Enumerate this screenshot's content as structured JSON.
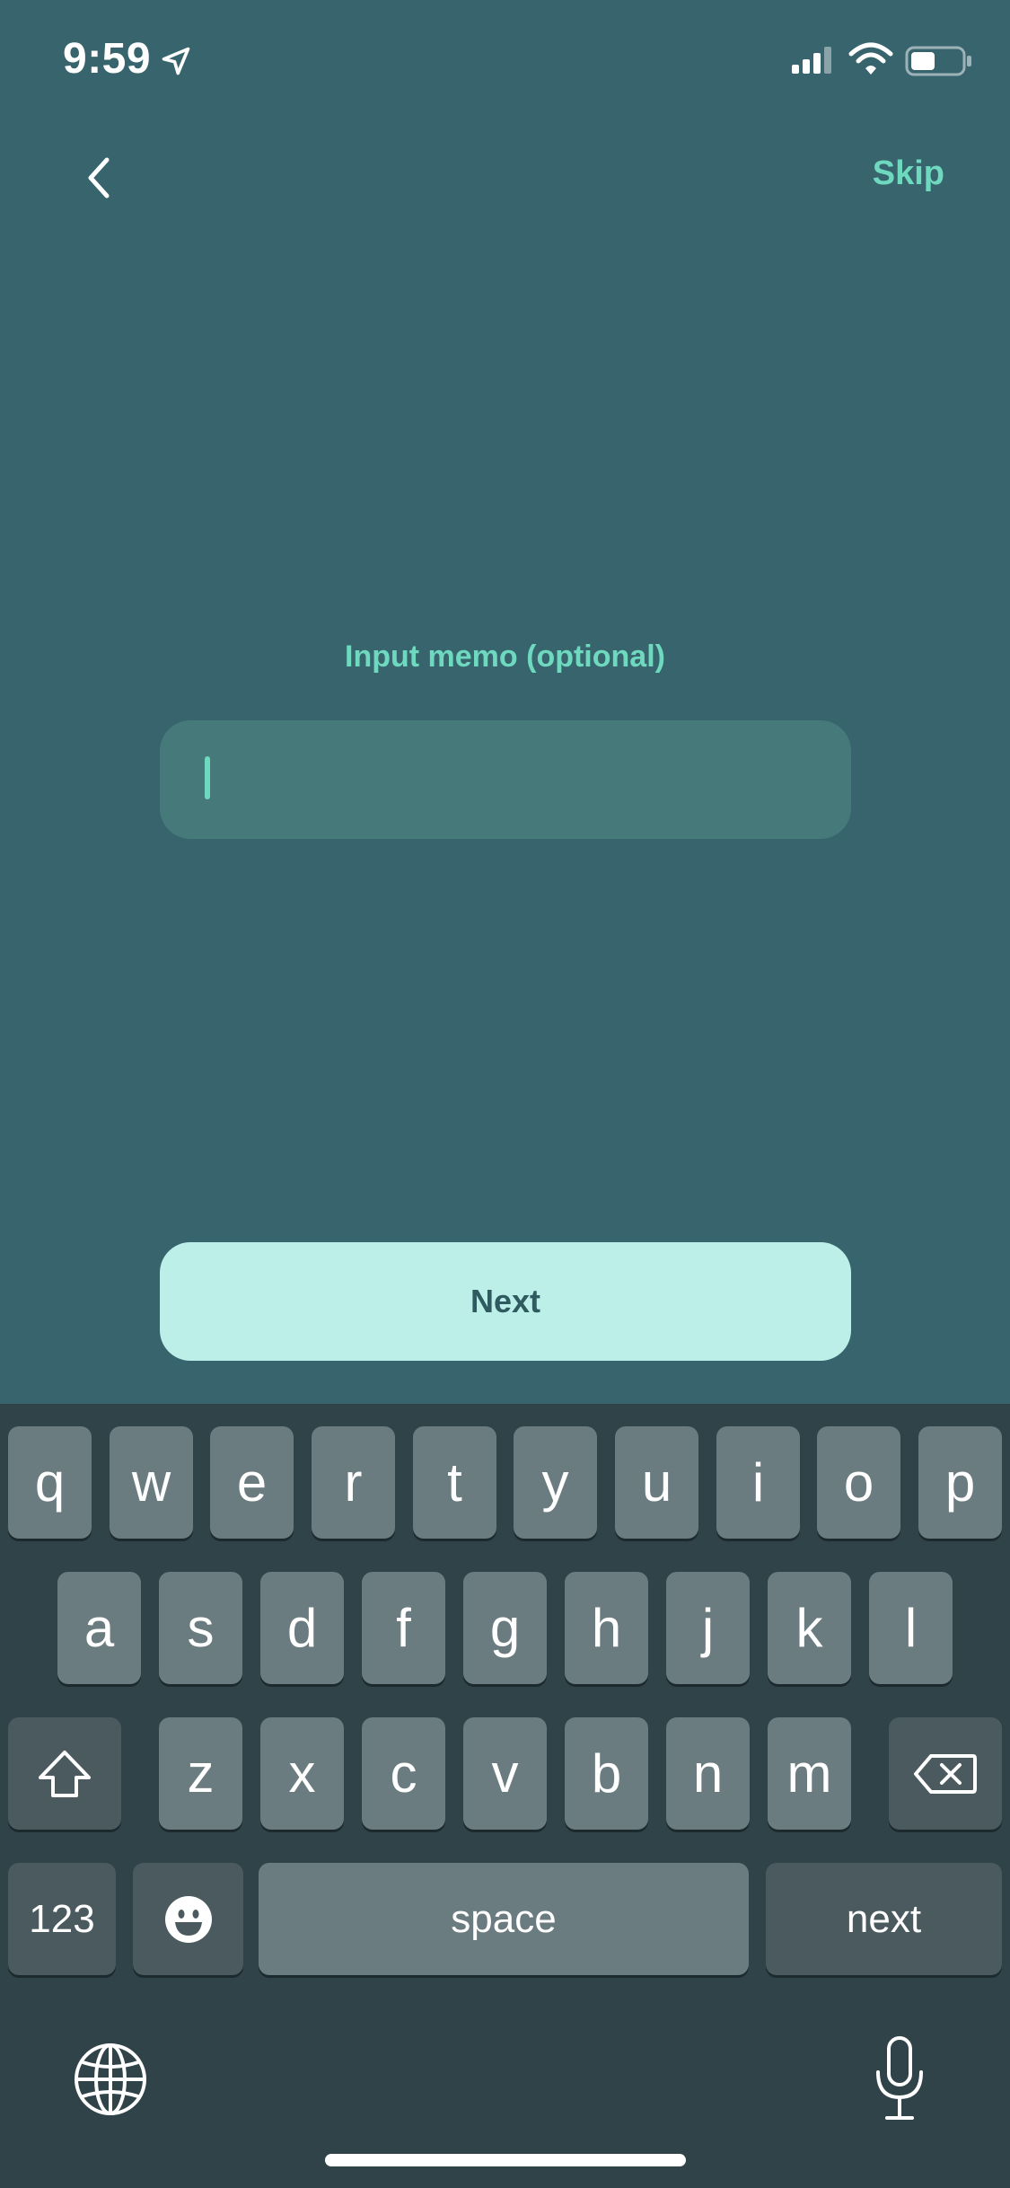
{
  "status_bar": {
    "time": "9:59"
  },
  "nav": {
    "skip_label": "Skip"
  },
  "memo": {
    "label": "Input memo (optional)",
    "value": "",
    "placeholder": ""
  },
  "next_button": {
    "label": "Next"
  },
  "keyboard": {
    "row1": [
      "q",
      "w",
      "e",
      "r",
      "t",
      "y",
      "u",
      "i",
      "o",
      "p"
    ],
    "row2": [
      "a",
      "s",
      "d",
      "f",
      "g",
      "h",
      "j",
      "k",
      "l"
    ],
    "row3": [
      "z",
      "x",
      "c",
      "v",
      "b",
      "n",
      "m"
    ],
    "numbers_label": "123",
    "space_label": "space",
    "return_label": "next"
  },
  "colors": {
    "background": "#37646d",
    "accent": "#6fd9bf",
    "button_bg": "#bbefe8",
    "keyboard_bg": "#2f4349"
  }
}
